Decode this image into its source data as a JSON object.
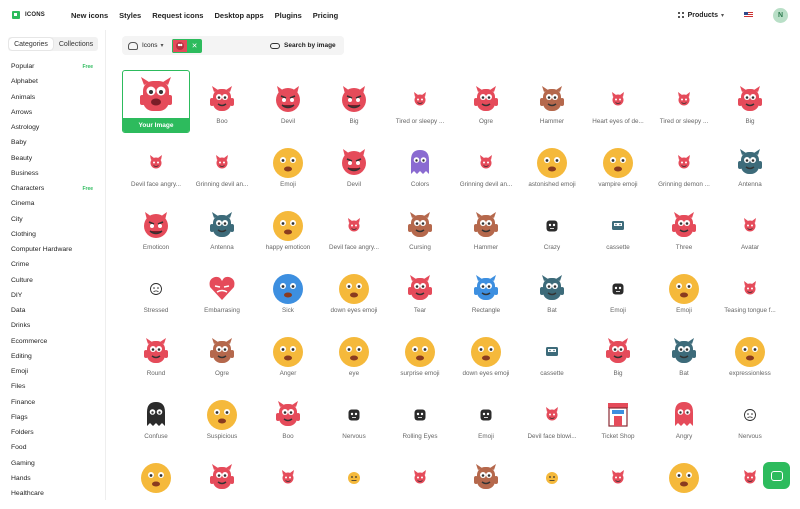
{
  "brand": {
    "name": "ICONS"
  },
  "nav": [
    "New icons",
    "Styles",
    "Request icons",
    "Desktop apps",
    "Plugins",
    "Pricing"
  ],
  "header_right": {
    "products_label": "Products",
    "avatar_initial": "N"
  },
  "sidebar": {
    "tabs": [
      "Categories",
      "Collections"
    ],
    "categories": [
      {
        "label": "Popular",
        "badge": "Free"
      },
      {
        "label": "Alphabet",
        "badge": ""
      },
      {
        "label": "Animals",
        "badge": ""
      },
      {
        "label": "Arrows",
        "badge": ""
      },
      {
        "label": "Astrology",
        "badge": ""
      },
      {
        "label": "Baby",
        "badge": ""
      },
      {
        "label": "Beauty",
        "badge": ""
      },
      {
        "label": "Business",
        "badge": ""
      },
      {
        "label": "Characters",
        "badge": "Free"
      },
      {
        "label": "Cinema",
        "badge": ""
      },
      {
        "label": "City",
        "badge": ""
      },
      {
        "label": "Clothing",
        "badge": ""
      },
      {
        "label": "Computer Hardware",
        "badge": ""
      },
      {
        "label": "Crime",
        "badge": ""
      },
      {
        "label": "Culture",
        "badge": ""
      },
      {
        "label": "DIY",
        "badge": ""
      },
      {
        "label": "Data",
        "badge": ""
      },
      {
        "label": "Drinks",
        "badge": ""
      },
      {
        "label": "Ecommerce",
        "badge": ""
      },
      {
        "label": "Editing",
        "badge": ""
      },
      {
        "label": "Emoji",
        "badge": ""
      },
      {
        "label": "Files",
        "badge": ""
      },
      {
        "label": "Finance",
        "badge": ""
      },
      {
        "label": "Flags",
        "badge": ""
      },
      {
        "label": "Folders",
        "badge": ""
      },
      {
        "label": "Food",
        "badge": ""
      },
      {
        "label": "Gaming",
        "badge": ""
      },
      {
        "label": "Hands",
        "badge": ""
      },
      {
        "label": "Healthcare",
        "badge": ""
      }
    ]
  },
  "search": {
    "type_label": "Icons",
    "search_by_image_label": "Search by image"
  },
  "your_image_label": "Your Image",
  "colors": {
    "accent": "#2dbb5d",
    "red": "#e54b5a",
    "yellow": "#f5b93b",
    "purple": "#8a6bd1",
    "teal": "#3d6b7a",
    "brown": "#b5684c",
    "blue": "#3d8fe0",
    "dark": "#2b2b2b"
  },
  "icon_rows": [
    [
      {
        "label": "Boo",
        "kind": "monster",
        "color": "red"
      },
      {
        "label": "Devil",
        "kind": "devil",
        "color": "red"
      },
      {
        "label": "Big",
        "kind": "devil",
        "color": "red"
      },
      {
        "label": "Tired or sleepy ...",
        "kind": "devil-small",
        "color": "red"
      },
      {
        "label": "Ogre",
        "kind": "monster",
        "color": "red"
      },
      {
        "label": "Hammer",
        "kind": "monster",
        "color": "brown"
      },
      {
        "label": "Heart eyes of de...",
        "kind": "devil-small",
        "color": "red"
      },
      {
        "label": "Tired or sleepy ...",
        "kind": "devil-small",
        "color": "red"
      },
      {
        "label": "Big",
        "kind": "monster",
        "color": "red"
      }
    ],
    [
      {
        "label": "Devil face angry...",
        "kind": "devil-small",
        "color": "red"
      },
      {
        "label": "Grinning devil an...",
        "kind": "devil-small",
        "color": "red"
      },
      {
        "label": "Emoji",
        "kind": "emoji",
        "color": "yellow"
      },
      {
        "label": "Devil",
        "kind": "devil",
        "color": "red"
      },
      {
        "label": "Colors",
        "kind": "ghost",
        "color": "purple"
      },
      {
        "label": "Grinning devil an...",
        "kind": "devil-small",
        "color": "red"
      },
      {
        "label": "astonished emoji",
        "kind": "emoji",
        "color": "yellow"
      },
      {
        "label": "vampire emoji",
        "kind": "emoji",
        "color": "yellow"
      },
      {
        "label": "Grinning demon ...",
        "kind": "devil-small",
        "color": "red"
      },
      {
        "label": "Antenna",
        "kind": "monster",
        "color": "teal"
      }
    ],
    [
      {
        "label": "Emoticon",
        "kind": "devil",
        "color": "red"
      },
      {
        "label": "Antenna",
        "kind": "monster",
        "color": "teal"
      },
      {
        "label": "happy emoticon",
        "kind": "emoji",
        "color": "yellow"
      },
      {
        "label": "Devil face angry...",
        "kind": "devil-small",
        "color": "red"
      },
      {
        "label": "Cursing",
        "kind": "monster",
        "color": "brown"
      },
      {
        "label": "Hammer",
        "kind": "monster",
        "color": "brown"
      },
      {
        "label": "Crazy",
        "kind": "dark-small",
        "color": "dark"
      },
      {
        "label": "cassette",
        "kind": "cassette",
        "color": "teal"
      },
      {
        "label": "Three",
        "kind": "monster",
        "color": "red"
      },
      {
        "label": "Avatar",
        "kind": "devil-small",
        "color": "red"
      }
    ],
    [
      {
        "label": "Stressed",
        "kind": "outline-small",
        "color": "dark"
      },
      {
        "label": "Embarrasing",
        "kind": "heart",
        "color": "red"
      },
      {
        "label": "Sick",
        "kind": "emoji",
        "color": "blue"
      },
      {
        "label": "down eyes emoji",
        "kind": "emoji",
        "color": "yellow"
      },
      {
        "label": "Tear",
        "kind": "monster",
        "color": "red"
      },
      {
        "label": "Rectangle",
        "kind": "monster",
        "color": "blue"
      },
      {
        "label": "Bat",
        "kind": "monster",
        "color": "teal"
      },
      {
        "label": "Emoji",
        "kind": "dark-small",
        "color": "dark"
      },
      {
        "label": "Emoji",
        "kind": "emoji",
        "color": "yellow"
      },
      {
        "label": "Teasing tongue f...",
        "kind": "devil-small",
        "color": "red"
      }
    ],
    [
      {
        "label": "Round",
        "kind": "monster",
        "color": "red"
      },
      {
        "label": "Ogre",
        "kind": "monster",
        "color": "brown"
      },
      {
        "label": "Anger",
        "kind": "emoji",
        "color": "yellow"
      },
      {
        "label": "eye",
        "kind": "emoji",
        "color": "yellow"
      },
      {
        "label": "surprise emoji",
        "kind": "emoji",
        "color": "yellow"
      },
      {
        "label": "down eyes emoji",
        "kind": "emoji",
        "color": "yellow"
      },
      {
        "label": "cassette",
        "kind": "cassette",
        "color": "teal"
      },
      {
        "label": "Big",
        "kind": "monster",
        "color": "red"
      },
      {
        "label": "Bat",
        "kind": "monster",
        "color": "teal"
      },
      {
        "label": "expressionless",
        "kind": "emoji",
        "color": "yellow"
      }
    ],
    [
      {
        "label": "Confuse",
        "kind": "ghost",
        "color": "dark"
      },
      {
        "label": "Suspicious",
        "kind": "emoji",
        "color": "yellow"
      },
      {
        "label": "Boo",
        "kind": "monster",
        "color": "red"
      },
      {
        "label": "Nervous",
        "kind": "dark-small",
        "color": "dark"
      },
      {
        "label": "Rolling Eyes",
        "kind": "dark-small",
        "color": "dark"
      },
      {
        "label": "Emoji",
        "kind": "dark-small",
        "color": "dark"
      },
      {
        "label": "Devil face blowi...",
        "kind": "devil-small",
        "color": "red"
      },
      {
        "label": "Ticket Shop",
        "kind": "shop",
        "color": "red"
      },
      {
        "label": "Angry",
        "kind": "ghost",
        "color": "red"
      },
      {
        "label": "Nervous",
        "kind": "outline-small",
        "color": "dark"
      }
    ],
    [
      {
        "label": "",
        "kind": "emoji",
        "color": "yellow"
      },
      {
        "label": "",
        "kind": "monster",
        "color": "red"
      },
      {
        "label": "",
        "kind": "devil-small",
        "color": "red"
      },
      {
        "label": "",
        "kind": "emoji-small",
        "color": "yellow"
      },
      {
        "label": "",
        "kind": "devil-small",
        "color": "red"
      },
      {
        "label": "",
        "kind": "monster",
        "color": "brown"
      },
      {
        "label": "",
        "kind": "emoji-small",
        "color": "yellow"
      },
      {
        "label": "",
        "kind": "devil-small",
        "color": "red"
      },
      {
        "label": "",
        "kind": "emoji",
        "color": "yellow"
      },
      {
        "label": "",
        "kind": "devil-small",
        "color": "red"
      }
    ]
  ]
}
